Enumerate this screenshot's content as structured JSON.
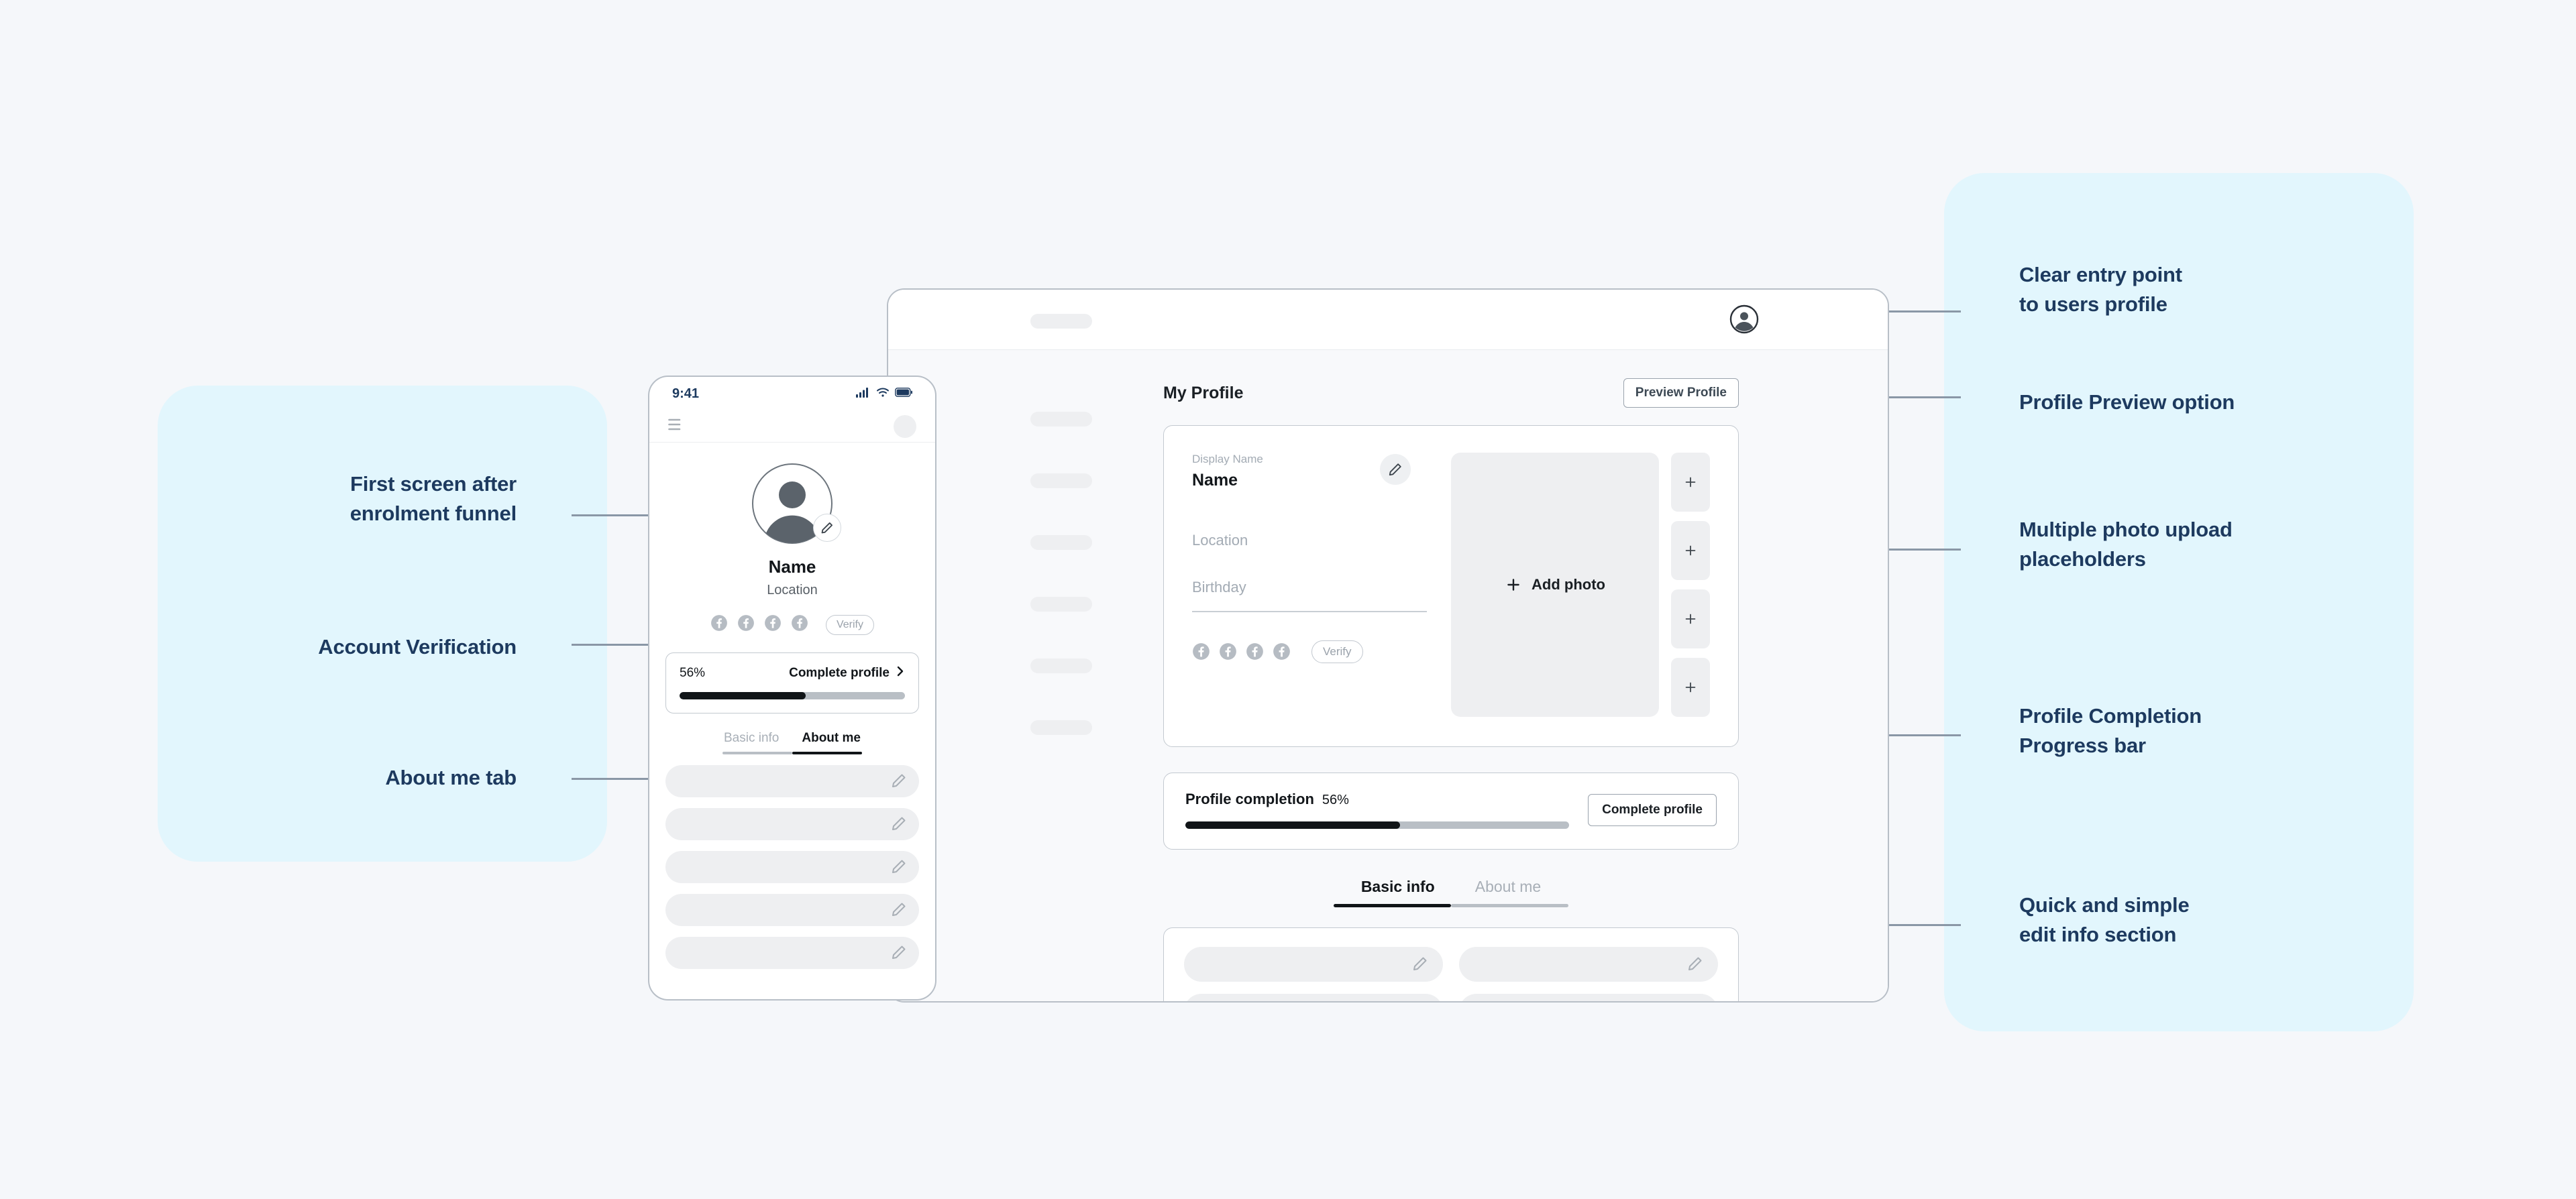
{
  "theme": {
    "page_bg": "#f5f7fa",
    "annotation_panel_bg": "#e2f6fd",
    "annotation_text": "#1d3a5f",
    "accent_dot": "#29b6f6",
    "connector_line": "#8a97a6",
    "placeholder_gray": "#eeeff1",
    "progress_fill": "#111518",
    "progress_track": "#b9bfc5"
  },
  "annotations": {
    "left": [
      {
        "id": "first-screen",
        "text": "First screen after\nenrolment funnel"
      },
      {
        "id": "account-verification",
        "text": "Account Verification"
      },
      {
        "id": "about-me-tab",
        "text": "About me tab"
      }
    ],
    "right": [
      {
        "id": "clear-entry-point",
        "text": "Clear entry point\nto users profile"
      },
      {
        "id": "profile-preview",
        "text": "Profile Preview option"
      },
      {
        "id": "multiple-photo",
        "text": "Multiple photo upload\nplaceholders"
      },
      {
        "id": "profile-completion",
        "text": "Profile Completion\nProgress bar"
      },
      {
        "id": "quick-edit",
        "text": "Quick and simple\nedit info section"
      }
    ]
  },
  "phone": {
    "status_bar": {
      "time": "9:41",
      "icons": [
        "signal-icon",
        "wifi-icon",
        "battery-icon"
      ]
    },
    "header": {
      "menu_icon": "hamburger-menu-icon",
      "avatar": "avatar-placeholder"
    },
    "profile": {
      "avatar_icon": "user-avatar-icon",
      "edit_icon": "pencil-icon",
      "name": "Name",
      "location": "Location",
      "social_icons": [
        "facebook-icon",
        "facebook-icon",
        "facebook-icon",
        "facebook-icon"
      ],
      "verify_label": "Verify"
    },
    "completion": {
      "percent_label": "56%",
      "percent_value": 56,
      "cta_label": "Complete profile",
      "chevron": "chevron-right-icon"
    },
    "tabs": [
      {
        "label": "Basic info",
        "active": false
      },
      {
        "label": "About me",
        "active": true
      }
    ],
    "list_rows": 5
  },
  "desktop": {
    "topbar": {
      "logo_placeholder": "bar-placeholder",
      "avatar_icon": "user-avatar-icon"
    },
    "sidebar": {
      "item_count": 6
    },
    "page_title": "My Profile",
    "preview_button": "Preview Profile",
    "profile_card": {
      "display_name_label": "Display Name",
      "display_name_value": "Name",
      "edit_icon": "pencil-icon",
      "location_placeholder": "Location",
      "birthday_placeholder": "Birthday",
      "social_icons": [
        "facebook-icon",
        "facebook-icon",
        "facebook-icon",
        "facebook-icon"
      ],
      "verify_label": "Verify",
      "add_photo_label": "Add photo",
      "add_photo_icon": "plus-icon",
      "photo_slots": 4,
      "photo_slot_icon": "plus-icon"
    },
    "completion": {
      "title": "Profile completion",
      "percent_label": "56%",
      "percent_value": 56,
      "cta_label": "Complete profile"
    },
    "tabs": [
      {
        "label": "Basic info",
        "active": true
      },
      {
        "label": "About me",
        "active": false
      }
    ],
    "info_rows": 4
  }
}
